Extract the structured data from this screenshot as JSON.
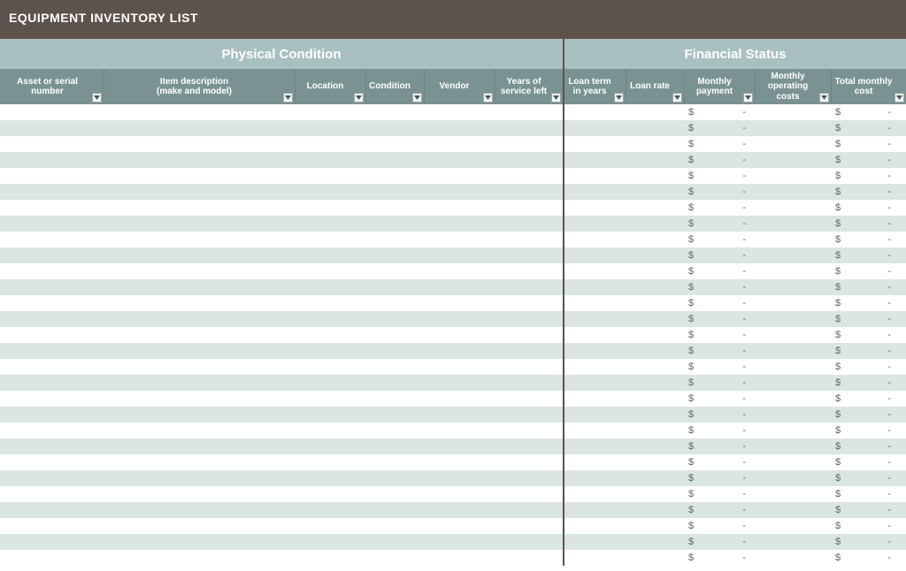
{
  "title": "EQUIPMENT INVENTORY LIST",
  "sections": {
    "physical": "Physical Condition",
    "financial": "Financial Status"
  },
  "columns": {
    "asset": "Asset or serial number",
    "desc_l1": "Item description",
    "desc_l2": "(make and model)",
    "location": "Location",
    "condition": "Condition",
    "vendor": "Vendor",
    "years_l1": "Years of",
    "years_l2": "service left",
    "term_l1": "Loan term",
    "term_l2": "in years",
    "rate": "Loan rate",
    "pay_l1": "Monthly",
    "pay_l2": "payment",
    "op_l1": "Monthly",
    "op_l2": "operating",
    "op_l3": "costs",
    "total_l1": "Total monthly",
    "total_l2": "cost"
  },
  "currency": "$",
  "dash": "-",
  "row_count": 29
}
